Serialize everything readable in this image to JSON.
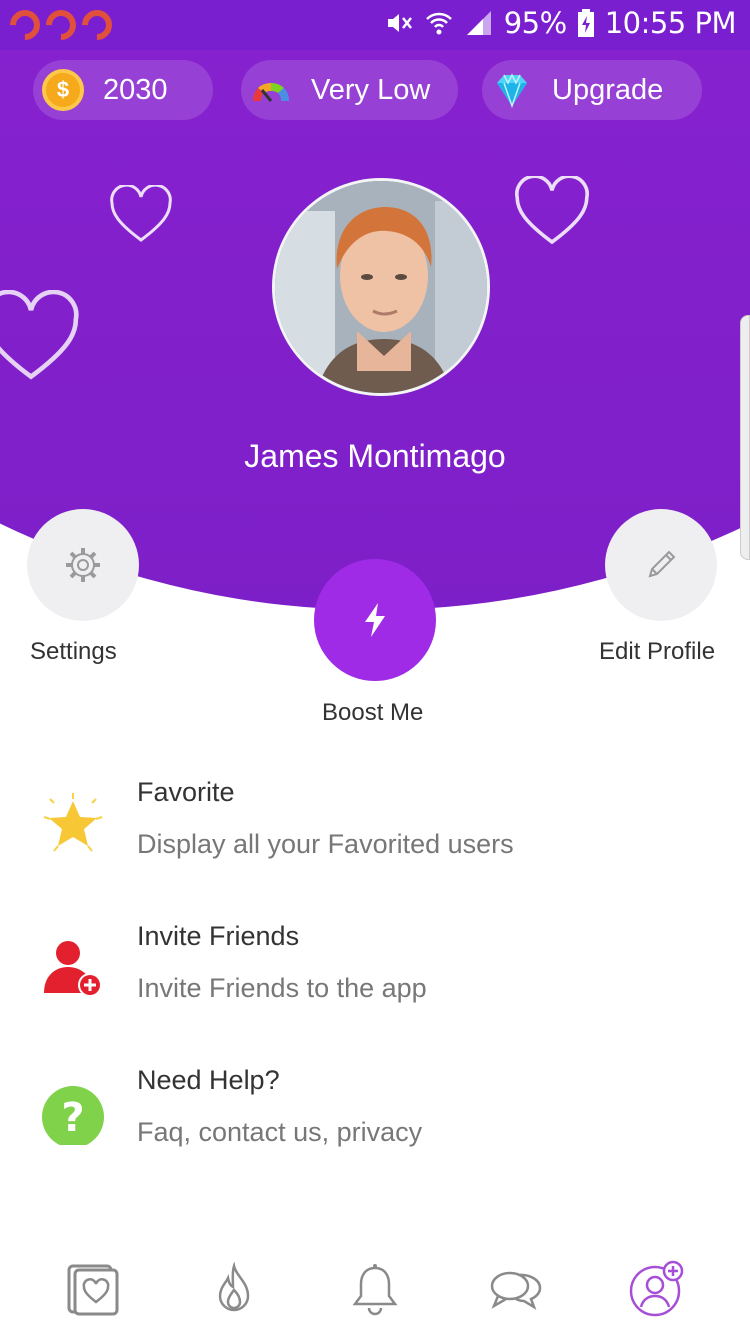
{
  "status_bar": {
    "battery": "95%",
    "time": "10:55 PM",
    "icons": [
      "notification-icon",
      "notification-icon",
      "notification-icon",
      "mute-icon",
      "wifi-icon",
      "signal-icon",
      "battery-charging-icon"
    ]
  },
  "top_pills": {
    "coins": {
      "icon": "coin-icon",
      "value": "2030"
    },
    "popularity": {
      "icon": "gauge-icon",
      "label": "Very Low"
    },
    "upgrade": {
      "icon": "diamond-icon",
      "label": "Upgrade"
    }
  },
  "profile": {
    "name": "James Montimago"
  },
  "actions": {
    "settings": {
      "icon": "gear-icon",
      "label": "Settings"
    },
    "boost": {
      "icon": "lightning-icon",
      "label": "Boost Me"
    },
    "edit_profile": {
      "icon": "pencil-icon",
      "label": "Edit Profile"
    }
  },
  "menu": [
    {
      "icon": "star-icon",
      "title": "Favorite",
      "subtitle": "Display all your Favorited users"
    },
    {
      "icon": "add-user-icon",
      "title": "Invite Friends",
      "subtitle": "Invite Friends to the app"
    },
    {
      "icon": "help-icon",
      "title": "Need Help?",
      "subtitle": "Faq, contact us, privacy"
    }
  ],
  "bottom_nav": [
    {
      "icon": "cards-icon",
      "active": false
    },
    {
      "icon": "flame-icon",
      "active": false
    },
    {
      "icon": "bell-icon",
      "active": false
    },
    {
      "icon": "chat-icon",
      "active": false
    },
    {
      "icon": "profile-icon",
      "active": true
    }
  ],
  "colors": {
    "primary": "#9b28e0",
    "status_bar": "#7a1fd0",
    "active_nav": "#a64ed8",
    "inactive_nav": "#8a8a8a"
  }
}
